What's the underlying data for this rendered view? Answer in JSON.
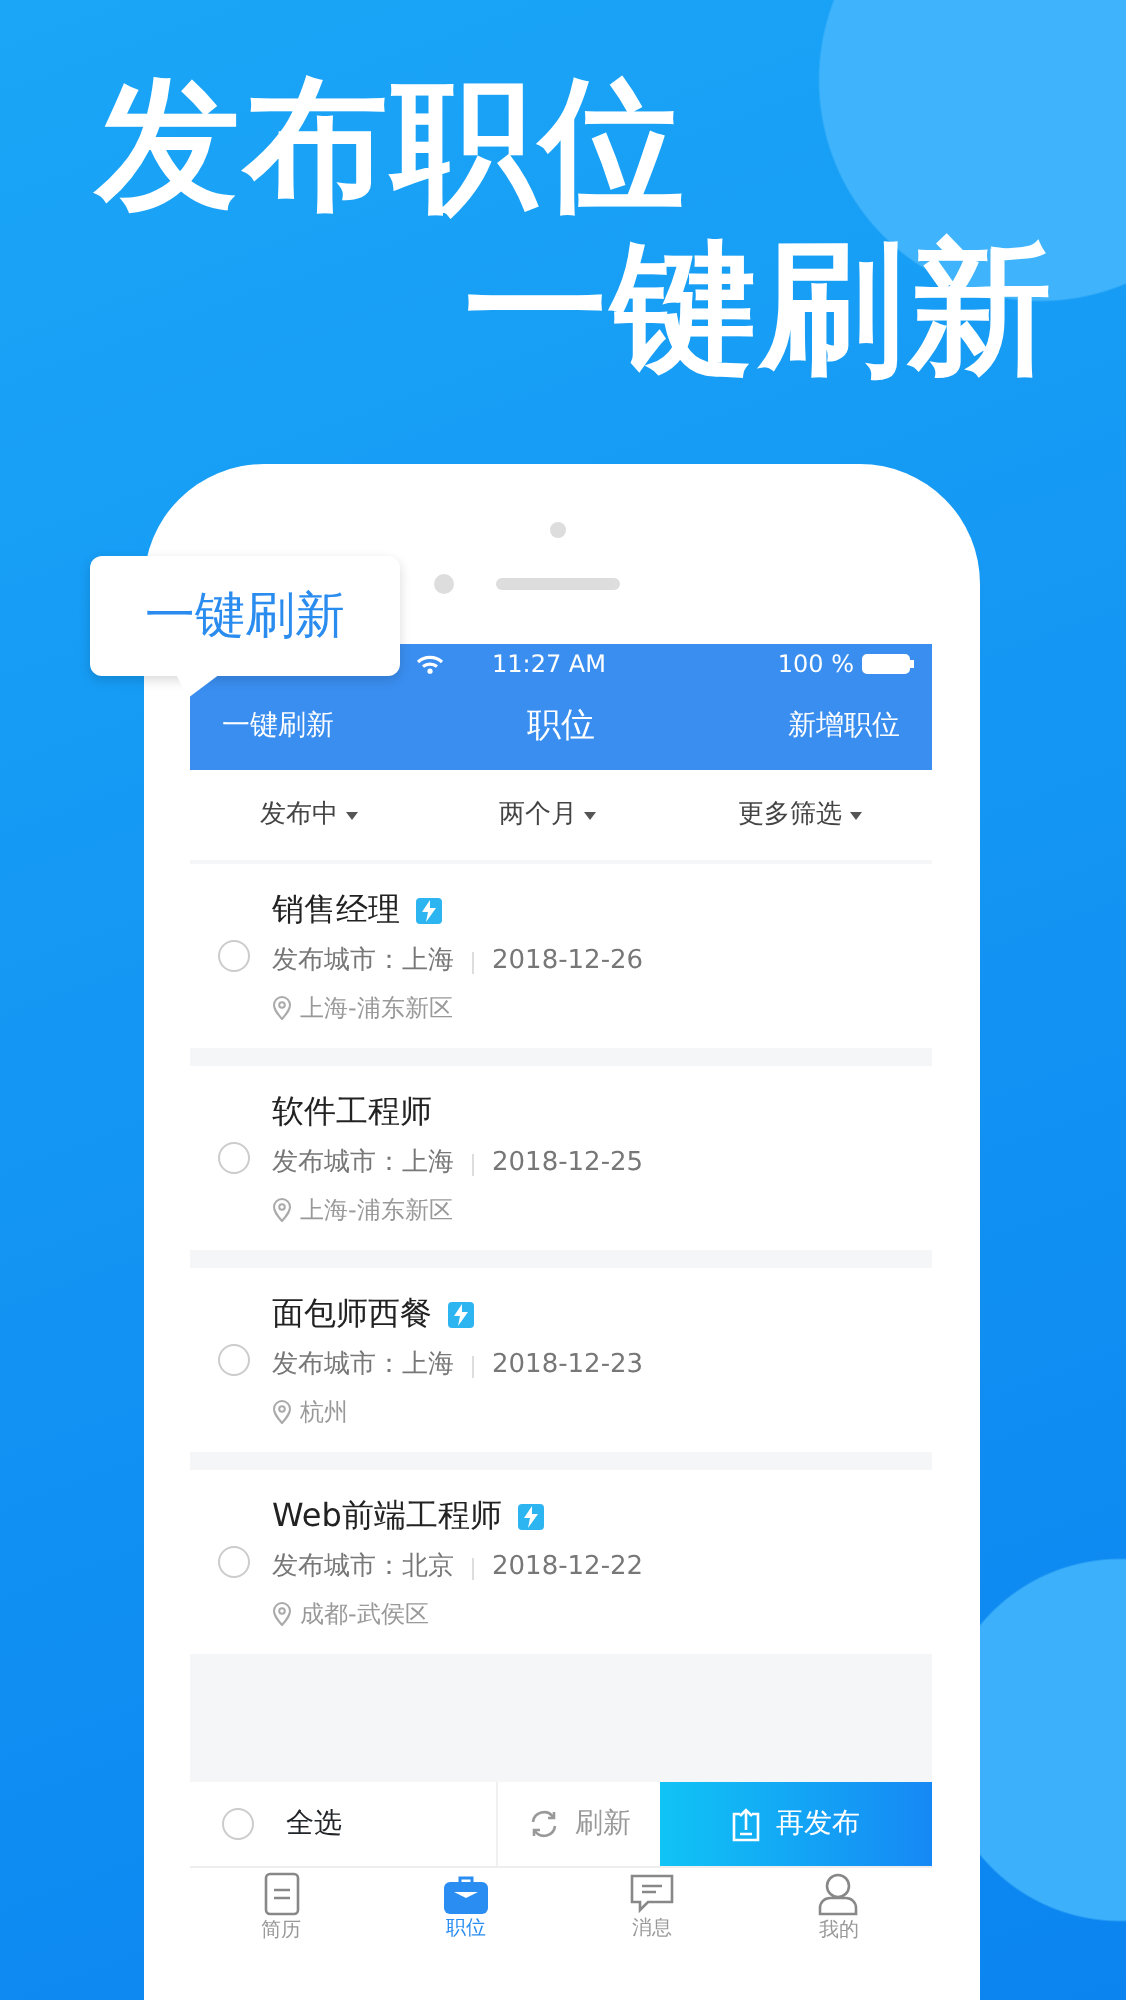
{
  "headline": [
    "发布职位",
    "一键刷新"
  ],
  "callout": "一键刷新",
  "status_bar": {
    "time": "11:27 AM",
    "battery": "100 %"
  },
  "nav": {
    "left": "一键刷新",
    "title": "职位",
    "right": "新增职位"
  },
  "filters": [
    "发布中",
    "两个月",
    "更多筛选"
  ],
  "jobs": [
    {
      "title": "销售经理",
      "refresh_badge": true,
      "checked": false,
      "city": "发布城市：上海",
      "date": "2018-12-26",
      "location": "上海-浦东新区"
    },
    {
      "title": "软件工程师",
      "refresh_badge": false,
      "checked": false,
      "city": "发布城市：上海",
      "date": "2018-12-25",
      "location": "上海-浦东新区"
    },
    {
      "title": "面包师西餐",
      "refresh_badge": true,
      "checked": false,
      "city": "发布城市：上海",
      "date": "2018-12-23",
      "location": "杭州"
    },
    {
      "title": "Web前端工程师",
      "refresh_badge": true,
      "checked": false,
      "city": "发布城市：北京",
      "date": "2018-12-22",
      "location": "成都-武侯区"
    }
  ],
  "actions": {
    "select_all": {
      "label": "全选",
      "checked": false
    },
    "refresh": "刷新",
    "republish": "再发布"
  },
  "tabs": [
    {
      "kind": "resume",
      "label": "简历",
      "selected": false
    },
    {
      "kind": "jobs",
      "label": "职位",
      "selected": true
    },
    {
      "kind": "messages",
      "label": "消息",
      "selected": false
    },
    {
      "kind": "profile",
      "label": "我的",
      "selected": false
    }
  ]
}
